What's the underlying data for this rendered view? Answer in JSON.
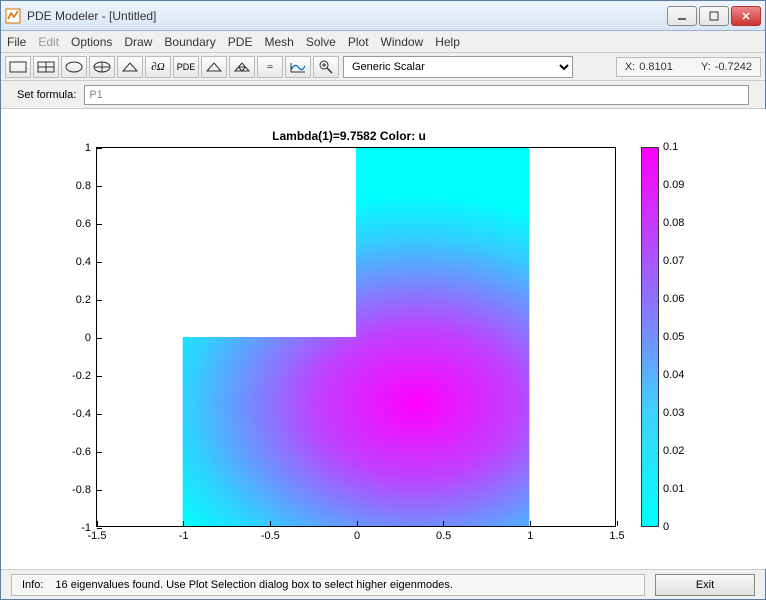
{
  "window": {
    "title": "PDE Modeler - [Untitled]"
  },
  "menu": {
    "items": [
      "File",
      "Edit",
      "Options",
      "Draw",
      "Boundary",
      "PDE",
      "Mesh",
      "Solve",
      "Plot",
      "Window",
      "Help"
    ],
    "disabled_index": 1
  },
  "toolbar": {
    "btn_pdomega": "∂Ω",
    "btn_pde": "PDE",
    "btn_equals": "=",
    "select_label": "Generic Scalar",
    "coord_x_label": "X:",
    "coord_x_value": "0.8101",
    "coord_y_label": "Y:",
    "coord_y_value": "-0.7242"
  },
  "formula": {
    "label": "Set formula:",
    "value": "P1"
  },
  "chart_data": {
    "type": "heatmap",
    "title": "Lambda(1)=9.7582   Color: u",
    "xlabel": "",
    "ylabel": "",
    "xlim": [
      -1.5,
      1.5
    ],
    "ylim": [
      -1,
      1
    ],
    "xticks": [
      -1.5,
      -1,
      -0.5,
      0,
      0.5,
      1,
      1.5
    ],
    "yticks": [
      -1,
      -0.8,
      -0.6,
      -0.4,
      -0.2,
      0,
      0.2,
      0.4,
      0.6,
      0.8,
      1
    ],
    "domain": "L-shape: union of squares [-1,0]x[-1,0], [0,1]x[-1,0], [0,1]x[0,1]",
    "colorbar": {
      "min": 0,
      "max": 0.1,
      "ticks": [
        0,
        0.01,
        0.02,
        0.03,
        0.04,
        0.05,
        0.06,
        0.07,
        0.08,
        0.09,
        0.1
      ],
      "colormap": "cool"
    },
    "peak": {
      "x": 0.35,
      "y": -0.35,
      "u": 0.1
    }
  },
  "status": {
    "prefix": "Info:",
    "message": "16 eigenvalues found. Use Plot Selection dialog box to select higher eigenmodes.",
    "exit_label": "Exit"
  }
}
